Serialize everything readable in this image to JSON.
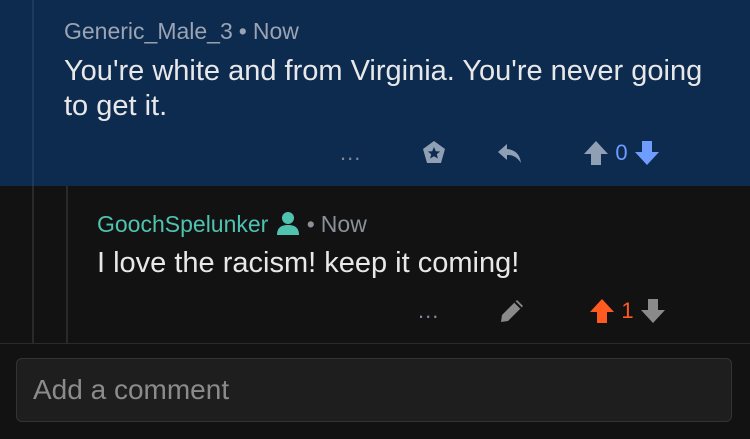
{
  "comments": [
    {
      "author": "Generic_Male_3",
      "time": "Now",
      "body": "You're white and from Virginia. You're never going to get it.",
      "more_label": "...",
      "score": "0"
    },
    {
      "author": "GoochSpelunker",
      "time": "Now",
      "body": "I love the racism! keep it coming!",
      "more_label": "...",
      "score": "1"
    }
  ],
  "comment_box": {
    "placeholder": "Add a comment"
  },
  "icons": {
    "award": "award-icon",
    "reply": "reply-icon",
    "edit": "pencil-icon",
    "upvote": "arrow-up-icon",
    "downvote": "arrow-down-icon",
    "user": "user-icon"
  },
  "colors": {
    "highlight_bg": "#0d2a4f",
    "upvoted": "#ff5a1f",
    "downvote_active": "#6f9cff",
    "author_green": "#4fc3b0"
  }
}
